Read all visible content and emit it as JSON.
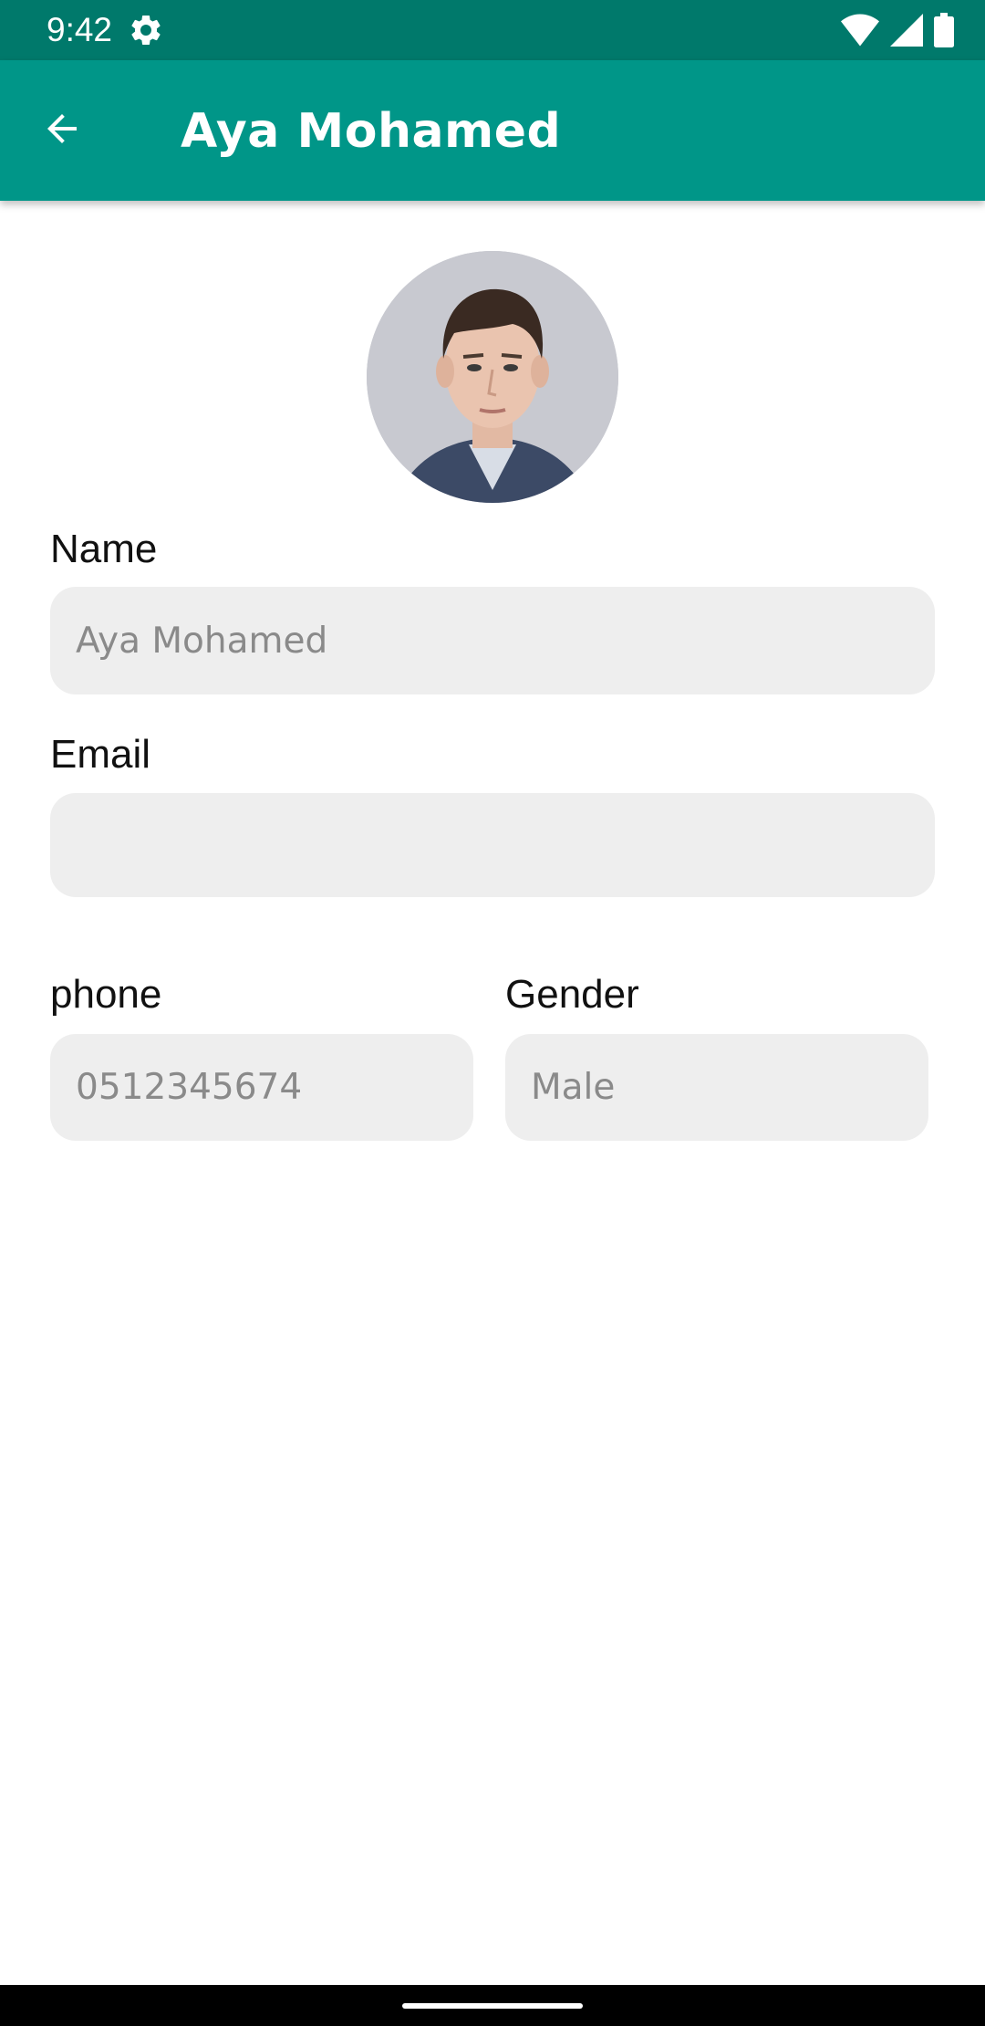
{
  "status_bar": {
    "time": "9:42",
    "icons": [
      "settings-icon",
      "wifi-icon",
      "signal-icon",
      "battery-icon"
    ]
  },
  "app_bar": {
    "title": "Aya Mohamed",
    "back_icon": "arrow-back-icon",
    "color": "#009688"
  },
  "profile": {
    "avatar_alt": "profile photo"
  },
  "form": {
    "name": {
      "label": "Name",
      "value": "Aya Mohamed"
    },
    "email": {
      "label": "Email",
      "value": ""
    },
    "phone": {
      "label": "phone",
      "value": "0512345674"
    },
    "gender": {
      "label": "Gender",
      "value": "Male"
    }
  },
  "colors": {
    "status_bar": "#00796b",
    "app_bar": "#009688",
    "field_background": "#eeeeee",
    "field_text": "#8a8a8a"
  }
}
